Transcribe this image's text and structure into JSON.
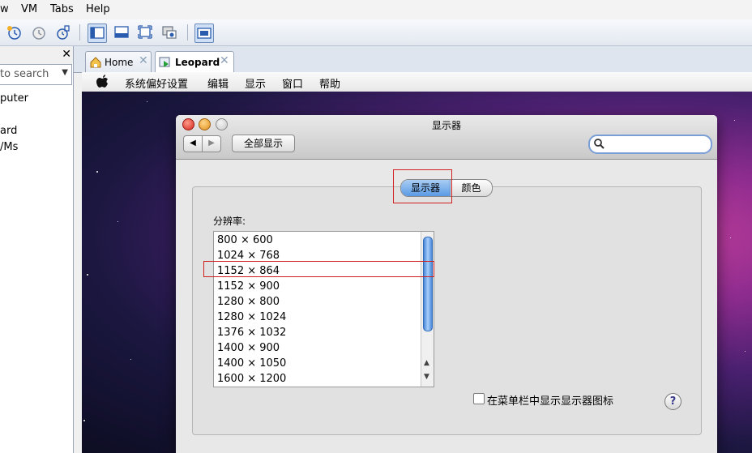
{
  "host": {
    "menu": [
      "w",
      "VM",
      "Tabs",
      "Help"
    ],
    "sidebar": {
      "close_glyph": "✕",
      "search_placeholder": "to search",
      "items": [
        "puter",
        "ard",
        "/Ms"
      ]
    },
    "tabs": [
      {
        "label": "Home",
        "close": "✕"
      },
      {
        "label": "Leopard",
        "close": "✕"
      }
    ]
  },
  "guest": {
    "menubar": {
      "apple": "",
      "items": [
        "系统偏好设置",
        "编辑",
        "显示",
        "窗口",
        "帮助"
      ]
    },
    "window": {
      "title": "显示器",
      "back": "◀",
      "forward": "▶",
      "show_all": "全部显示",
      "segments": [
        "显示器",
        "颜色"
      ],
      "resolution_label": "分辨率:",
      "resolutions": [
        "800 × 600",
        "1024 × 768",
        "1152 × 864",
        "1152 × 900",
        "1280 × 800",
        "1280 × 1024",
        "1376 × 1032",
        "1400 × 900",
        "1400 × 1050",
        "1600 × 1200"
      ],
      "selected_resolution": "1152 × 864",
      "checkbox_label": "在菜单栏中显示显示器图标",
      "help": "?"
    }
  },
  "colors": {
    "selection_highlight": "#d02020",
    "segment_selected": "#5a9ae4"
  }
}
